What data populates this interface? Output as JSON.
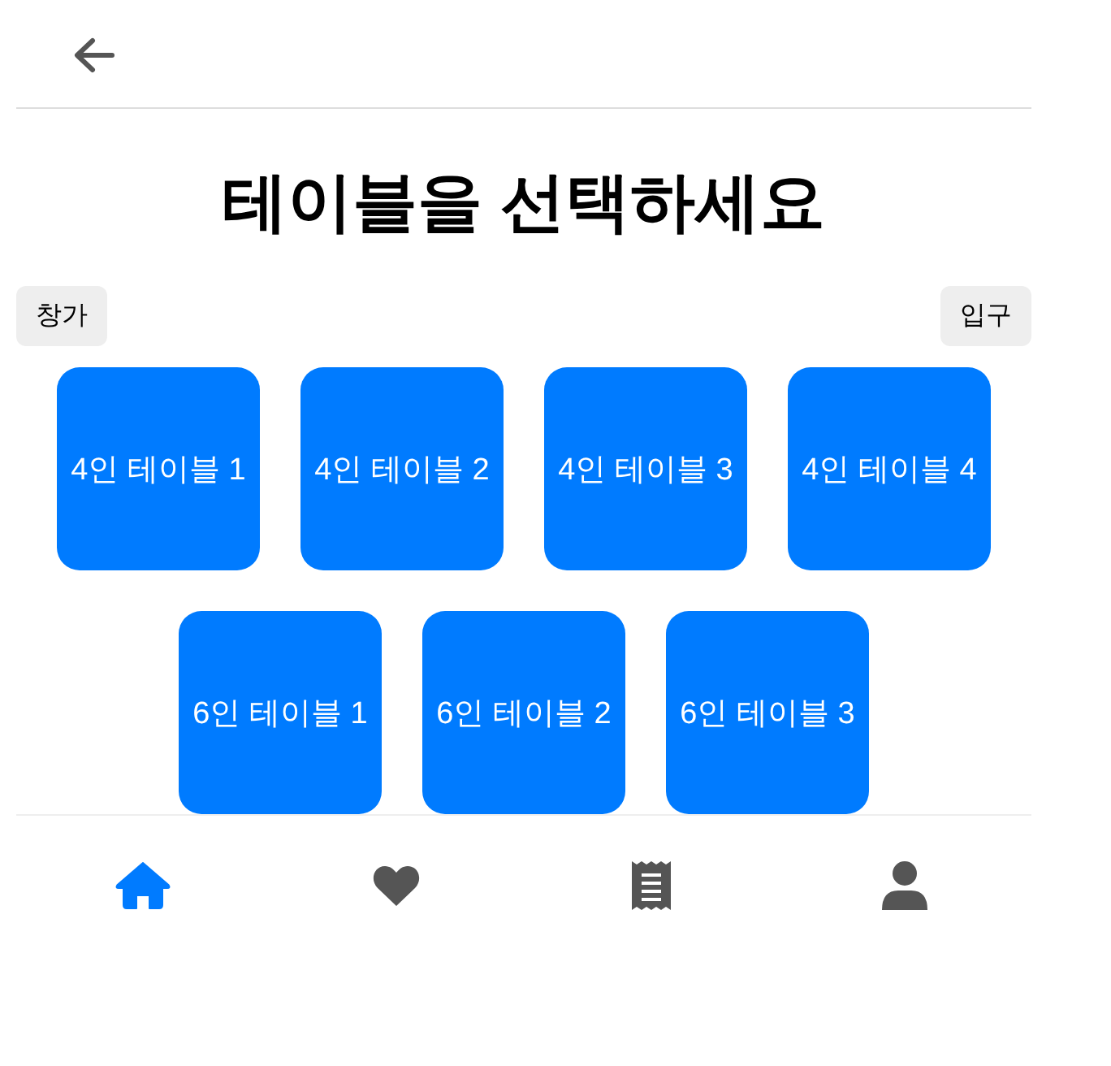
{
  "title": "테이블을 선택하세요",
  "zone_tags": [
    "창가",
    "입구"
  ],
  "tables": [
    "4인 테이블 1",
    "4인 테이블 2",
    "4인 테이블 3",
    "4인 테이블 4",
    "6인 테이블 1",
    "6인 테이블 2",
    "6인 테이블 3"
  ],
  "nav": {
    "items": [
      {
        "kind": "home",
        "selected": true
      },
      {
        "kind": "heart",
        "selected": false
      },
      {
        "kind": "receipt",
        "selected": false
      },
      {
        "kind": "user",
        "selected": false
      }
    ]
  }
}
